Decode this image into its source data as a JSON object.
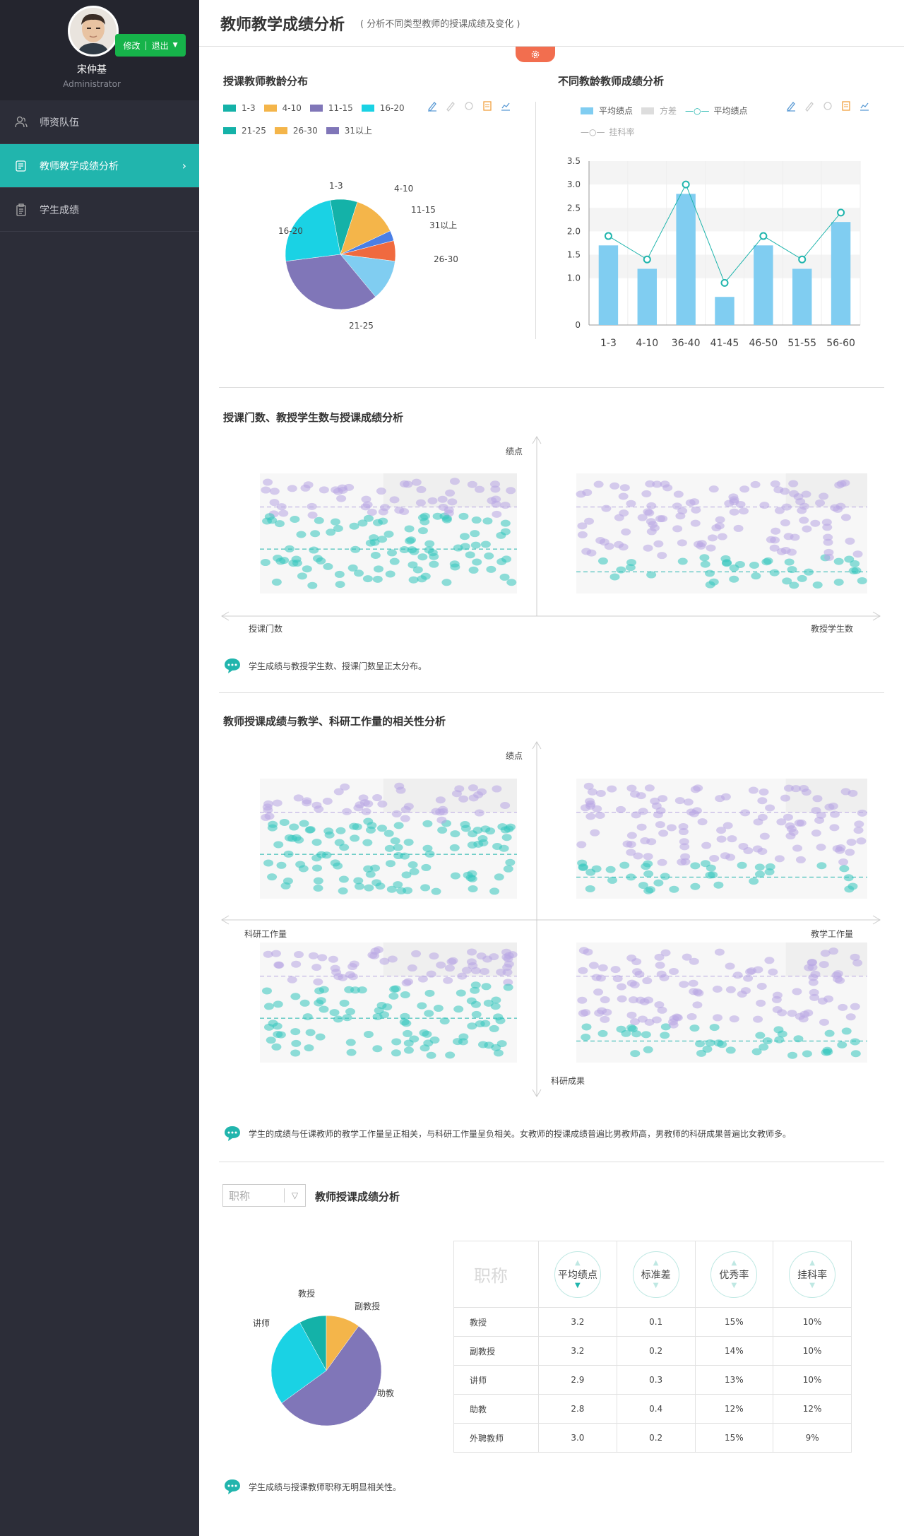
{
  "user": {
    "name": "宋仲基",
    "role": "Administrator",
    "edit": "修改",
    "logout": "退出"
  },
  "nav": [
    {
      "label": "师资队伍"
    },
    {
      "label": "教师教学成绩分析"
    },
    {
      "label": "学生成绩"
    }
  ],
  "header": {
    "title": "教师教学成绩分析",
    "subtitle": "( 分析不同类型教师的授课成绩及变化 )"
  },
  "colors": {
    "teal": "#21b5ad",
    "sidebar": "#2c2d38",
    "accent": "#f26e4f",
    "green": "#16b34a"
  },
  "section1": {
    "title": "授课教师教龄分布",
    "legend": [
      "1-3",
      "4-10",
      "11-15",
      "16-20",
      "21-25",
      "26-30",
      "31以上"
    ],
    "labels": {
      "l1": "1-3",
      "l2": "4-10",
      "l3": "31以上",
      "l4": "11-15",
      "l5": "16-20",
      "l6": "26-30",
      "l7": "21-25"
    }
  },
  "section2": {
    "title": "不同教龄教师成绩分析",
    "legend": {
      "bar": "平均绩点",
      "var": "方差",
      "line": "平均绩点",
      "fail": "挂科率"
    }
  },
  "section3": {
    "title": "授课门数、教授学生数与授课成绩分析",
    "axis_y": "绩点",
    "axis_left": "授课门数",
    "axis_right": "教授学生数",
    "note": "学生成绩与教授学生数、授课门数呈正太分布。"
  },
  "section4": {
    "title": "教师授课成绩与教学、科研工作量的相关性分析",
    "axis_y": "绩点",
    "axis_left": "科研工作量",
    "axis_right": "教学工作量",
    "axis_bottom": "科研成果",
    "note": "学生的成绩与任课教师的教学工作量呈正相关，与科研工作量呈负相关。女教师的授课成绩普遍比男教师高，男教师的科研成果普遍比女教师多。"
  },
  "section5": {
    "title": "教师授课成绩分析",
    "select": "职称",
    "pie_labels": {
      "prof": "教授",
      "assoc": "副教授",
      "lect": "讲师",
      "asst": "助教"
    },
    "note": "学生成绩与授课教师职称无明显相关性。",
    "table": {
      "head": [
        "职称",
        "平均绩点",
        "标准差",
        "优秀率",
        "挂科率"
      ],
      "rows": [
        [
          "教授",
          "3.2",
          "0.1",
          "15%",
          "10%"
        ],
        [
          "副教授",
          "3.2",
          "0.2",
          "14%",
          "10%"
        ],
        [
          "讲师",
          "2.9",
          "0.3",
          "13%",
          "10%"
        ],
        [
          "助教",
          "2.8",
          "0.4",
          "12%",
          "12%"
        ],
        [
          "外聘教师",
          "3.0",
          "0.2",
          "15%",
          "9%"
        ]
      ]
    }
  },
  "chart_data": [
    {
      "type": "pie",
      "title": "授课教师教龄分布",
      "categories": [
        "1-3",
        "4-10",
        "11-15",
        "31以上",
        "26-30",
        "21-25",
        "16-20"
      ],
      "values": [
        8,
        13,
        3,
        6,
        12,
        34,
        24
      ],
      "colors": [
        "#14b2a8",
        "#f4b54a",
        "#4a7fe6",
        "#f06a3f",
        "#80cdf1",
        "#8076b8",
        "#1ad2e4"
      ]
    },
    {
      "type": "bar",
      "title": "不同教龄教师成绩分析",
      "categories": [
        "1-3",
        "4-10",
        "36-40",
        "41-45",
        "46-50",
        "51-55",
        "56-60"
      ],
      "ylim": [
        0,
        3.5
      ],
      "yticks": [
        "0",
        "1.0",
        "1.5",
        "2.0",
        "2.5",
        "3.0",
        "3.5"
      ],
      "series": [
        {
          "name": "平均绩点",
          "kind": "bar",
          "values": [
            1.7,
            1.2,
            2.8,
            0.6,
            1.7,
            1.2,
            2.2
          ]
        },
        {
          "name": "平均绩点",
          "kind": "line",
          "values": [
            1.9,
            1.4,
            3.0,
            0.9,
            1.9,
            1.4,
            2.4
          ]
        }
      ]
    },
    {
      "type": "pie",
      "title": "教师授课成绩分析",
      "categories": [
        "教授",
        "副教授",
        "助教",
        "讲师"
      ],
      "values": [
        8,
        10,
        55,
        27
      ],
      "colors": [
        "#14b2a8",
        "#f4b54a",
        "#8076b8",
        "#1ad2e4"
      ]
    }
  ]
}
